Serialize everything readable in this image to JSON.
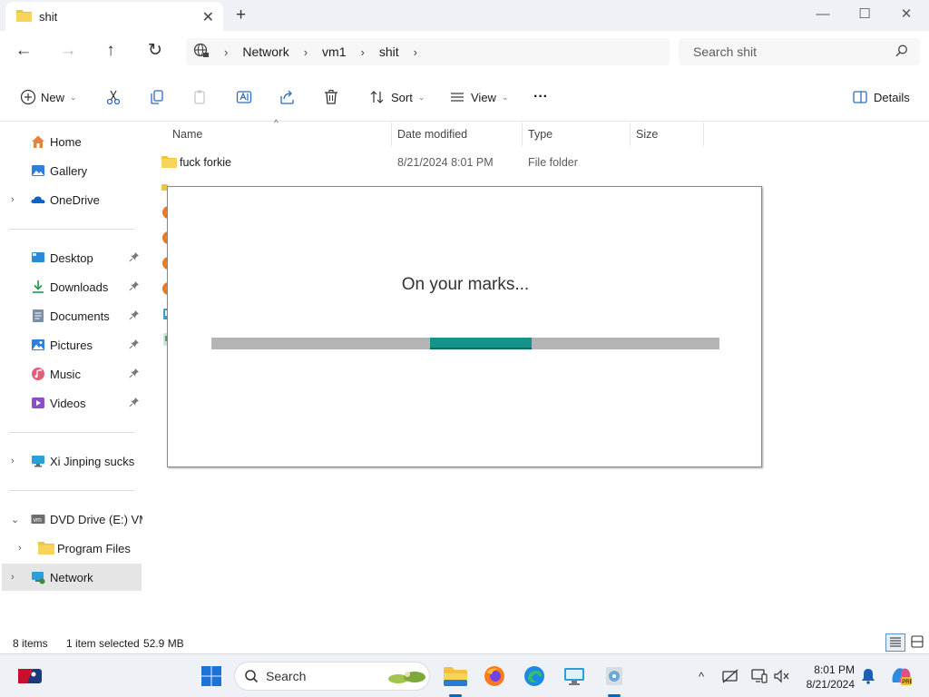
{
  "window": {
    "tab_title": "shit",
    "close_tab_glyph": "✕",
    "new_tab_glyph": "+"
  },
  "window_controls": {
    "minimize": "—",
    "maximize": "☐",
    "close": "✕"
  },
  "navigation": {
    "back": "←",
    "forward": "→",
    "up": "↑",
    "refresh": "↻",
    "breadcrumb": [
      "Network",
      "vm1",
      "shit"
    ],
    "breadcrumb_sep": "›",
    "search_placeholder": "Search shit"
  },
  "command_bar": {
    "new_label": "New",
    "sort_label": "Sort",
    "view_label": "View",
    "more_label": "···",
    "details_label": "Details",
    "caret": "⌄"
  },
  "sidebar": {
    "chevron_right": "›",
    "chevron_down": "⌄",
    "items": [
      {
        "label": "Home",
        "icon": "home-icon"
      },
      {
        "label": "Gallery",
        "icon": "gallery-icon"
      },
      {
        "label": "OneDrive",
        "icon": "onedrive-icon"
      },
      {
        "label": "Desktop",
        "icon": "desktop-icon"
      },
      {
        "label": "Downloads",
        "icon": "downloads-icon"
      },
      {
        "label": "Documents",
        "icon": "documents-icon"
      },
      {
        "label": "Pictures",
        "icon": "pictures-icon"
      },
      {
        "label": "Music",
        "icon": "music-icon"
      },
      {
        "label": "Videos",
        "icon": "videos-icon"
      },
      {
        "label": "Xi Jinping sucks",
        "icon": "computer-icon"
      },
      {
        "label": "DVD Drive (E:) VMware Tools",
        "icon": "dvd-drive-icon"
      },
      {
        "label": "Program Files",
        "icon": "folder-icon"
      },
      {
        "label": "Network",
        "icon": "network-icon"
      }
    ]
  },
  "file_list": {
    "columns": [
      "Name",
      "Date modified",
      "Type",
      "Size"
    ],
    "sort_indicator": "^",
    "rows": [
      {
        "name": "fuck forkie",
        "date": "8/21/2024 8:01 PM",
        "type": "File folder"
      }
    ]
  },
  "dialog": {
    "message": "On your marks...",
    "progress_start": 0.43,
    "progress_end": 0.63,
    "accent": "#13938a"
  },
  "status_bar": {
    "item_count": "8 items",
    "selection": "1 item selected",
    "size": "52.9 MB"
  },
  "taskbar": {
    "search_label": "Search",
    "time": "8:01 PM",
    "date": "8/21/2024",
    "tray_up": "^"
  },
  "colors": {
    "selection_bg": "#e5e5e5",
    "folder_yellow": "#f3c23c",
    "accent_blue": "#0067c0"
  }
}
